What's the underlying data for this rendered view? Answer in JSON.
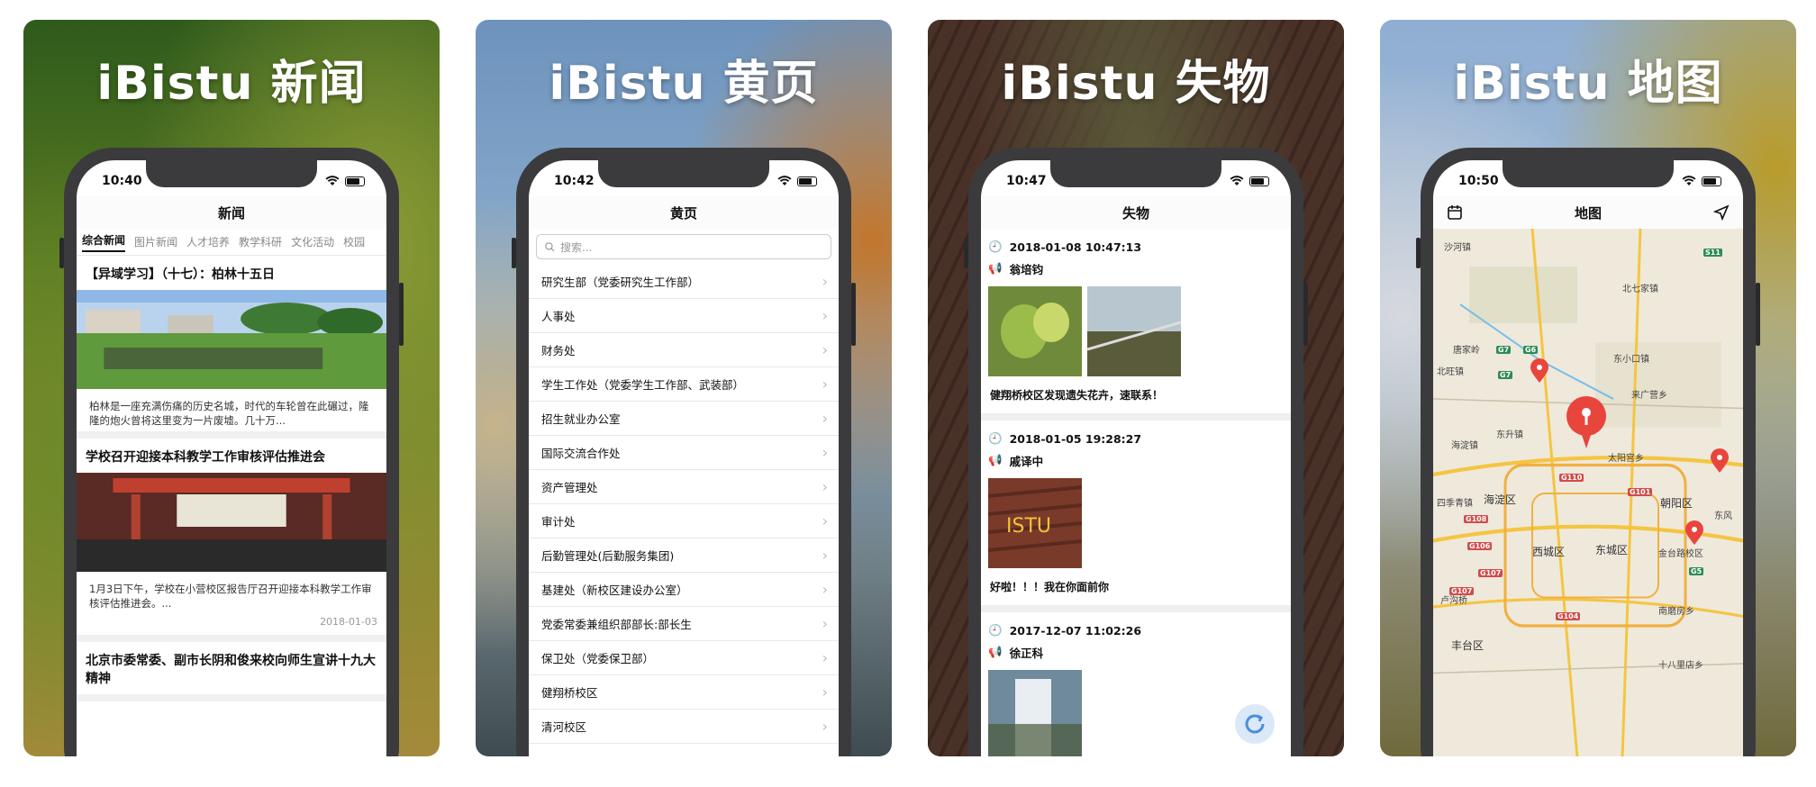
{
  "cards": [
    {
      "title": "iBistu 新闻",
      "time": "10:40",
      "nav_title": "新闻",
      "categories": [
        "综合新闻",
        "图片新闻",
        "人才培养",
        "教学科研",
        "文化活动",
        "校园"
      ],
      "news": [
        {
          "title": "【异域学习】（十七）：柏林十五日",
          "desc": "柏林是一座充满伤痛的历史名城，时代的车轮曾在此碾过，隆隆的炮火曾将这里变为一片废墟。几十万...",
          "date": ""
        },
        {
          "title": "学校召开迎接本科教学工作审核评估推进会",
          "desc": "1月3日下午，学校在小营校区报告厅召开迎接本科教学工作审核评估推进会。...",
          "date": "2018-01-03"
        },
        {
          "title": "北京市委常委、副市长阴和俊来校向师生宣讲十九大精神",
          "desc": "",
          "date": ""
        }
      ]
    },
    {
      "title": "iBistu 黄页",
      "time": "10:42",
      "nav_title": "黄页",
      "search_placeholder": "搜索...",
      "items": [
        "研究生部（党委研究生工作部）",
        "人事处",
        "财务处",
        "学生工作处（党委学生工作部、武装部）",
        "招生就业办公室",
        "国际交流合作处",
        "资产管理处",
        "审计处",
        "后勤管理处(后勤服务集团)",
        "基建处（新校区建设办公室）",
        "党委常委兼组织部部长:部长生",
        "保卫处（党委保卫部）",
        "健翔桥校区",
        "清河校区"
      ]
    },
    {
      "title": "iBistu 失物",
      "time": "10:47",
      "nav_title": "失物",
      "posts": [
        {
          "datetime": "2018-01-08 10:47:13",
          "user": "翁培钧",
          "text": "健翔桥校区发现遗失花卉，速联系！"
        },
        {
          "datetime": "2018-01-05 19:28:27",
          "user": "戚译中",
          "text": "好啦！！！我在你面前你"
        },
        {
          "datetime": "2017-12-07 11:02:26",
          "user": "徐正科",
          "text": ""
        }
      ]
    },
    {
      "title": "iBistu 地图",
      "time": "10:50",
      "nav_title": "地图",
      "places": [
        "沙河镇",
        "北七家镇",
        "唐家岭",
        "东小口镇",
        "北旺镇",
        "来广营乡",
        "东升镇",
        "海淀镇",
        "太阳宫乡",
        "四季青镇",
        "海淀区",
        "朝阳区",
        "西城区",
        "东城区",
        "金台路校区",
        "卢沟桥",
        "南磨房乡",
        "丰台区",
        "十八里店乡",
        "东风"
      ],
      "roads": [
        "S11",
        "G7",
        "G6",
        "G7",
        "G110",
        "G101",
        "G108",
        "G106",
        "G107",
        "G107",
        "G104",
        "G5"
      ]
    }
  ],
  "tab_icons": [
    "chat-icon",
    "card-icon",
    "search-icon",
    "send-icon",
    "person-icon"
  ],
  "colors": {
    "accent": "#e8453c",
    "map_bg": "#efe9dc",
    "road": "#f5c542"
  }
}
